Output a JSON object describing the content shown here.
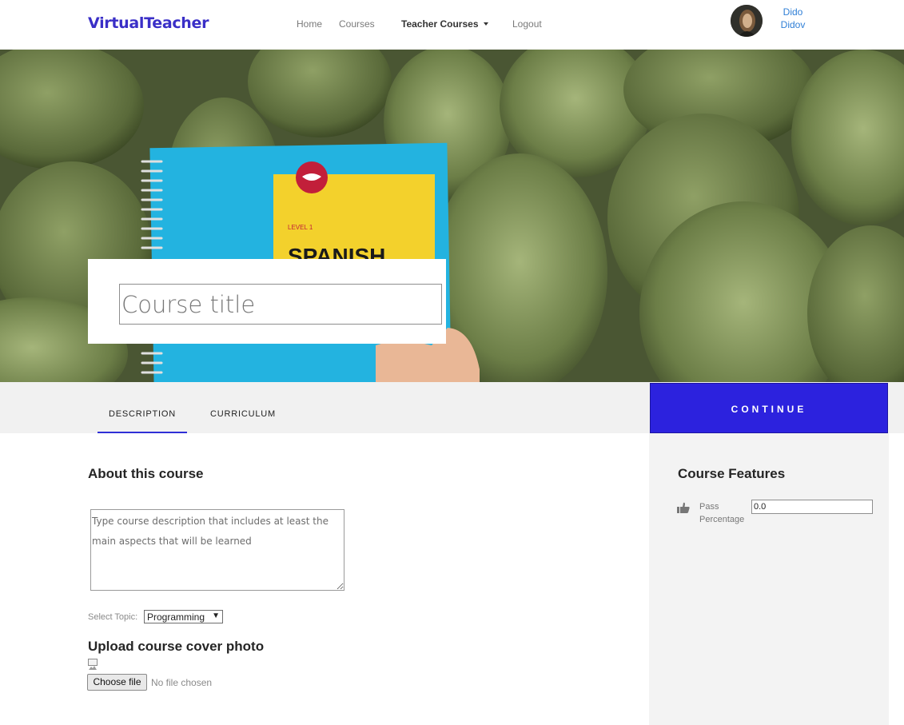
{
  "navbar": {
    "brand": "VirtualTeacher",
    "links": {
      "home": "Home",
      "courses": "Courses",
      "teacher_courses": "Teacher Courses",
      "logout": "Logout"
    },
    "user": {
      "first_name": "Dido",
      "last_name": "Didov"
    }
  },
  "hero": {
    "title_placeholder": "Course title",
    "notebook": {
      "level": "LEVEL 1",
      "word": "SPANISH"
    }
  },
  "tabs": {
    "description": "DESCRIPTION",
    "curriculum": "CURRICULUM",
    "active": "description"
  },
  "continue_label": "CONTINUE",
  "main": {
    "about_heading": "About this course",
    "description_placeholder": "Type course description that includes at least the main aspects that will be learned",
    "topic_label": "Select Topic:",
    "topic_selected": "Programming",
    "upload_heading": "Upload course cover photo",
    "choose_file_label": "Choose file",
    "no_file_text": "No file chosen"
  },
  "sidebar": {
    "heading": "Course Features",
    "pass_label": "Pass Percentage",
    "pass_value": "0.0"
  },
  "colors": {
    "brand": "#3a2fc7",
    "continue_bg": "#2c22de",
    "user_link": "#2f7fd6",
    "tab_underline": "#2f2fd6"
  }
}
